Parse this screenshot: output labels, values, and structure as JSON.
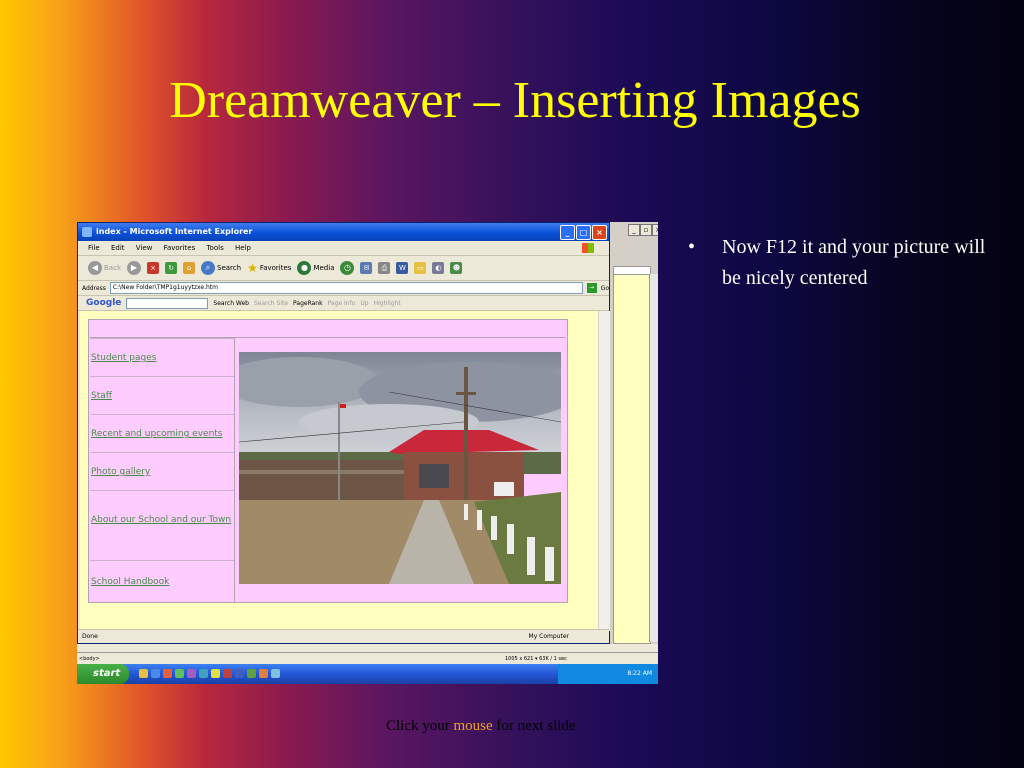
{
  "slide": {
    "title": "Dreamweaver –   Inserting Images",
    "bullets": [
      "Now F12 it and your picture will be nicely centered"
    ],
    "footer_prefix": "Click your ",
    "footer_mouse": "mouse",
    "footer_suffix": " for next slide"
  },
  "ie": {
    "title": "index - Microsoft Internet Explorer",
    "menu": [
      "File",
      "Edit",
      "View",
      "Favorites",
      "Tools",
      "Help"
    ],
    "toolbar": {
      "back": "Back",
      "search": "Search",
      "favorites": "Favorites",
      "media": "Media"
    },
    "address_label": "Address",
    "address_value": "C:\\New Folder\\TMP1g1uyytzxe.htm",
    "go_label": "Go",
    "google": {
      "logo": "Google",
      "search_web": "Search Web",
      "search_site": "Search Site",
      "pagerank": "PageRank",
      "page_info": "Page Info",
      "up": "Up",
      "highlight": "Highlight"
    },
    "nav_items": [
      "Student  pages",
      "Staff",
      "Recent  and  upcoming  events",
      "Photo  gallery",
      "About  our School and our Town",
      "School Handbook"
    ],
    "status_left": "Done",
    "status_zone": "My Computer"
  },
  "dw": {
    "tag": "<body>",
    "size": "1005 x 621 ▾  63K / 1 sec"
  },
  "taskbar": {
    "start": "start",
    "clock": "8:22 AM"
  },
  "colors": {
    "title": "#ffff00",
    "link": "#4a8c4a",
    "page_bg": "#ffffc0",
    "table_bg": "#ffccff"
  }
}
